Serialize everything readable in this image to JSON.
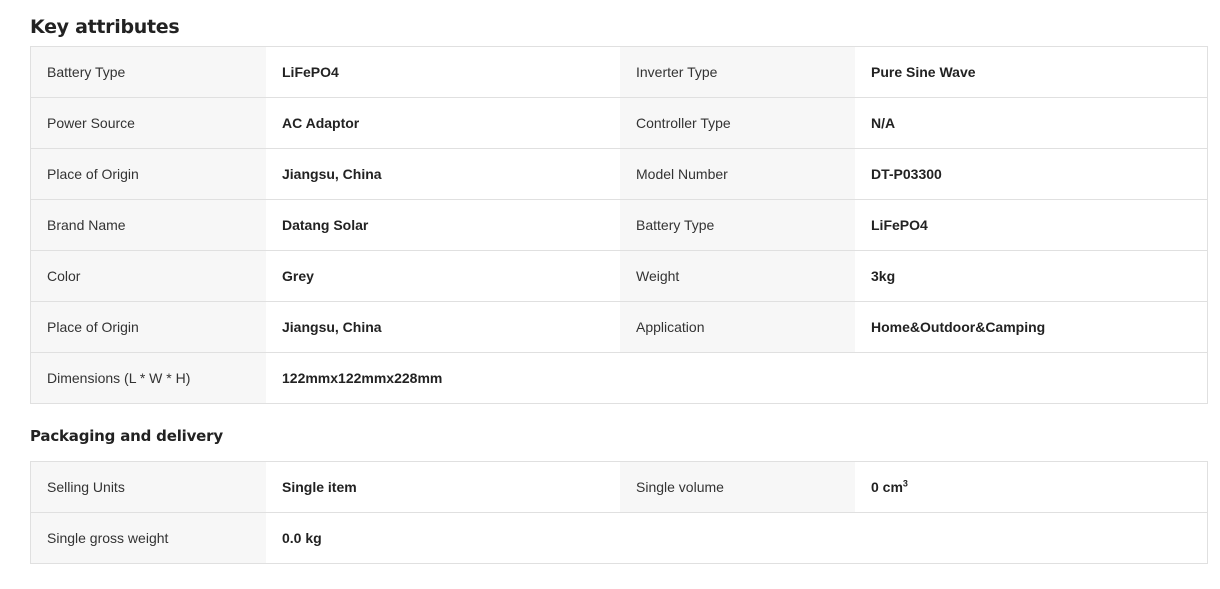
{
  "key_attributes": {
    "title": "Key attributes",
    "rows": [
      [
        {
          "key": "Battery Type",
          "value": "LiFePO4"
        },
        {
          "key": "Inverter Type",
          "value": "Pure Sine Wave"
        }
      ],
      [
        {
          "key": "Power Source",
          "value": "AC Adaptor"
        },
        {
          "key": "Controller Type",
          "value": "N/A"
        }
      ],
      [
        {
          "key": "Place of Origin",
          "value": "Jiangsu, China"
        },
        {
          "key": "Model Number",
          "value": "DT-P03300"
        }
      ],
      [
        {
          "key": "Brand Name",
          "value": "Datang Solar"
        },
        {
          "key": "Battery Type",
          "value": "LiFePO4"
        }
      ],
      [
        {
          "key": "Color",
          "value": "Grey"
        },
        {
          "key": "Weight",
          "value": "3kg"
        }
      ],
      [
        {
          "key": "Place of Origin",
          "value": "Jiangsu, China"
        },
        {
          "key": "Application",
          "value": "Home&Outdoor&Camping"
        }
      ],
      [
        {
          "key": "Dimensions (L * W * H)",
          "value": "122mmx122mmx228mm"
        }
      ]
    ]
  },
  "packaging": {
    "title": "Packaging and delivery",
    "rows": [
      [
        {
          "key": "Selling Units",
          "value": "Single item"
        },
        {
          "key": "Single volume",
          "value": "0 cm",
          "value_sup": "3"
        }
      ],
      [
        {
          "key": "Single gross weight",
          "value": "0.0 kg"
        }
      ]
    ]
  }
}
